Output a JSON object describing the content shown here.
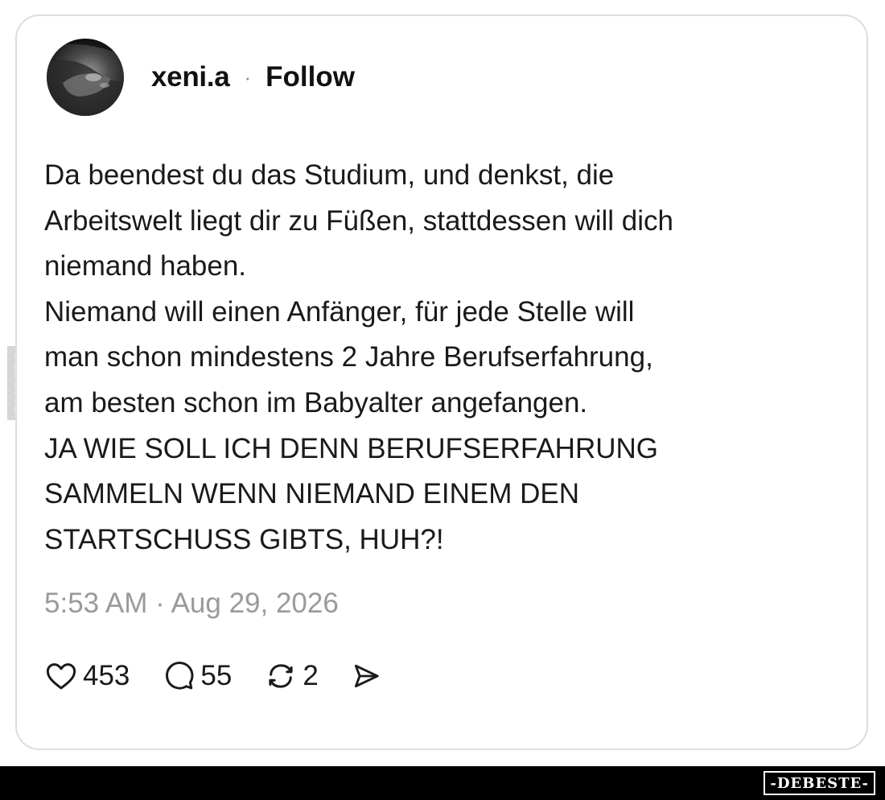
{
  "post": {
    "author": {
      "username": "xeni.a",
      "separator": "·",
      "follow_label": "Follow"
    },
    "body_lines": [
      "Da beendest du das Studium, und denkst, die",
      "Arbeitswelt liegt dir zu Füßen, stattdessen will dich",
      "niemand haben.",
      "Niemand will einen Anfänger, für jede Stelle will",
      "man schon mindestens 2 Jahre Berufserfahrung,",
      "am besten schon im Babyalter angefangen.",
      "JA WIE SOLL ICH DENN BERUFSERFAHRUNG",
      "SAMMELN WENN NIEMAND EINEM DEN",
      "STARTSCHUSS GIBTS, HUH?!"
    ],
    "timestamp": "5:53 AM · Aug 29, 2026",
    "actions": {
      "likes": {
        "icon": "heart-icon",
        "count": "453"
      },
      "comments": {
        "icon": "comment-bubble-icon",
        "count": "55"
      },
      "reposts": {
        "icon": "repost-icon",
        "count": "2"
      },
      "share": {
        "icon": "send-icon"
      }
    }
  },
  "watermark": {
    "side_text": "DEBESTE",
    "footer_text": "-DEBESTE-"
  },
  "colors": {
    "text": "#1a1a1a",
    "muted": "#9a9a9a",
    "card_border": "#dddddd",
    "footer_bg": "#000000"
  }
}
